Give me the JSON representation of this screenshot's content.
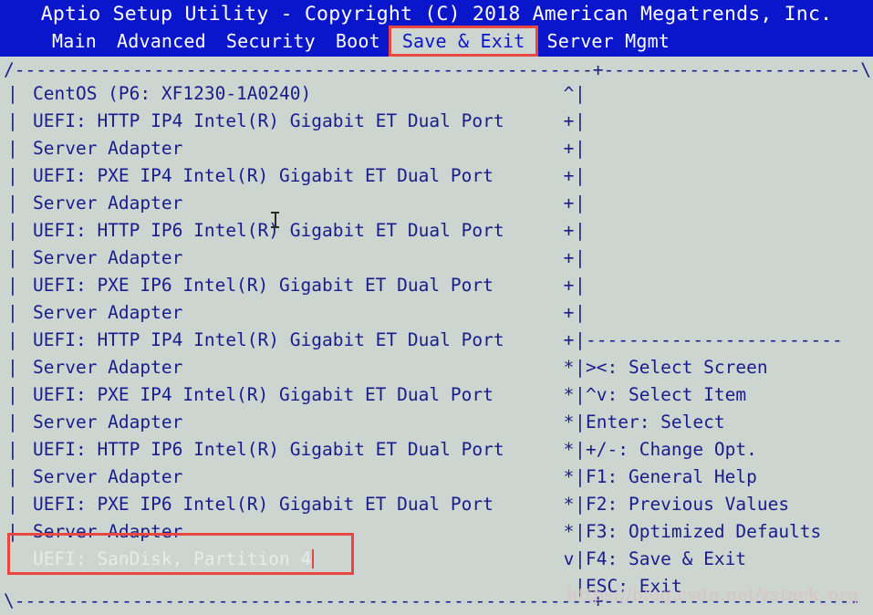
{
  "window": {
    "title": "Aptio Setup Utility - Copyright (C) 2018 American Megatrends, Inc.",
    "bg_color": "#ccd5cf",
    "title_bg_color": "#0a16cc",
    "text_color": "#191d8c",
    "accent_color": "#e8473f"
  },
  "menu": {
    "items": [
      {
        "label": "Main",
        "active": false
      },
      {
        "label": "Advanced",
        "active": false
      },
      {
        "label": "Security",
        "active": false
      },
      {
        "label": "Boot",
        "active": false
      },
      {
        "label": "Save & Exit",
        "active": true
      },
      {
        "label": "Server Mgmt",
        "active": false
      }
    ]
  },
  "frame": {
    "top_border": "/------------------------------------------------------+------------------------\\",
    "bottom_border": "\\------------------------------------------------------+------------------------"
  },
  "boot_list": {
    "rows": [
      {
        "gutter": "|",
        "label": "CentOS (P6: XF1230-1A0240)",
        "dim": false
      },
      {
        "gutter": "|",
        "label": "UEFI: HTTP IP4 Intel(R) Gigabit ET Dual Port",
        "dim": false
      },
      {
        "gutter": "|",
        "label": "Server Adapter",
        "dim": false
      },
      {
        "gutter": "|",
        "label": "UEFI: PXE IP4 Intel(R) Gigabit ET Dual Port",
        "dim": false
      },
      {
        "gutter": "|",
        "label": "Server Adapter",
        "dim": false
      },
      {
        "gutter": "|",
        "label": "UEFI: HTTP IP6 Intel(R) Gigabit ET Dual Port",
        "dim": false
      },
      {
        "gutter": "|",
        "label": "Server Adapter",
        "dim": false
      },
      {
        "gutter": "|",
        "label": "UEFI: PXE IP6 Intel(R) Gigabit ET Dual Port",
        "dim": false
      },
      {
        "gutter": "|",
        "label": "Server Adapter",
        "dim": false
      },
      {
        "gutter": "|",
        "label": "UEFI: HTTP IP4 Intel(R) Gigabit ET Dual Port",
        "dim": false
      },
      {
        "gutter": "|",
        "label": "Server Adapter",
        "dim": false
      },
      {
        "gutter": "|",
        "label": "UEFI: PXE IP4 Intel(R) Gigabit ET Dual Port",
        "dim": false
      },
      {
        "gutter": "|",
        "label": "Server Adapter",
        "dim": false
      },
      {
        "gutter": "|",
        "label": "UEFI: HTTP IP6 Intel(R) Gigabit ET Dual Port",
        "dim": false
      },
      {
        "gutter": "|",
        "label": "Server Adapter",
        "dim": false
      },
      {
        "gutter": "|",
        "label": "UEFI: PXE IP6 Intel(R) Gigabit ET Dual Port",
        "dim": false
      },
      {
        "gutter": "|",
        "label": "Server Adapter",
        "dim": false
      },
      {
        "gutter": "|",
        "label": "UEFI: SanDisk, Partition 4",
        "dim": true
      }
    ]
  },
  "rail": {
    "rows": [
      {
        "scroll": "^",
        "bar": "|",
        "help": ""
      },
      {
        "scroll": "+",
        "bar": "|",
        "help": ""
      },
      {
        "scroll": "+",
        "bar": "|",
        "help": ""
      },
      {
        "scroll": "+",
        "bar": "|",
        "help": ""
      },
      {
        "scroll": "+",
        "bar": "|",
        "help": ""
      },
      {
        "scroll": "+",
        "bar": "|",
        "help": ""
      },
      {
        "scroll": "+",
        "bar": "|",
        "help": ""
      },
      {
        "scroll": "+",
        "bar": "|",
        "help": ""
      },
      {
        "scroll": "+",
        "bar": "|",
        "help": ""
      },
      {
        "scroll": "+",
        "bar": "|",
        "help": "------------------------"
      },
      {
        "scroll": "*",
        "bar": "|",
        "help": "><: Select Screen"
      },
      {
        "scroll": "*",
        "bar": "|",
        "help": "^v: Select Item"
      },
      {
        "scroll": "*",
        "bar": "|",
        "help": "Enter: Select"
      },
      {
        "scroll": "*",
        "bar": "|",
        "help": "+/-: Change Opt."
      },
      {
        "scroll": "*",
        "bar": "|",
        "help": "F1: General Help"
      },
      {
        "scroll": "*",
        "bar": "|",
        "help": "F2: Previous Values"
      },
      {
        "scroll": "*",
        "bar": "|",
        "help": "F3: Optimized Defaults"
      },
      {
        "scroll": "v",
        "bar": "|",
        "help": "F4: Save & Exit"
      },
      {
        "scroll": " ",
        "bar": "|",
        "help": "ESC: Exit"
      }
    ]
  },
  "watermark": {
    "text": "https://blog.csdn.net/zstack_org"
  }
}
